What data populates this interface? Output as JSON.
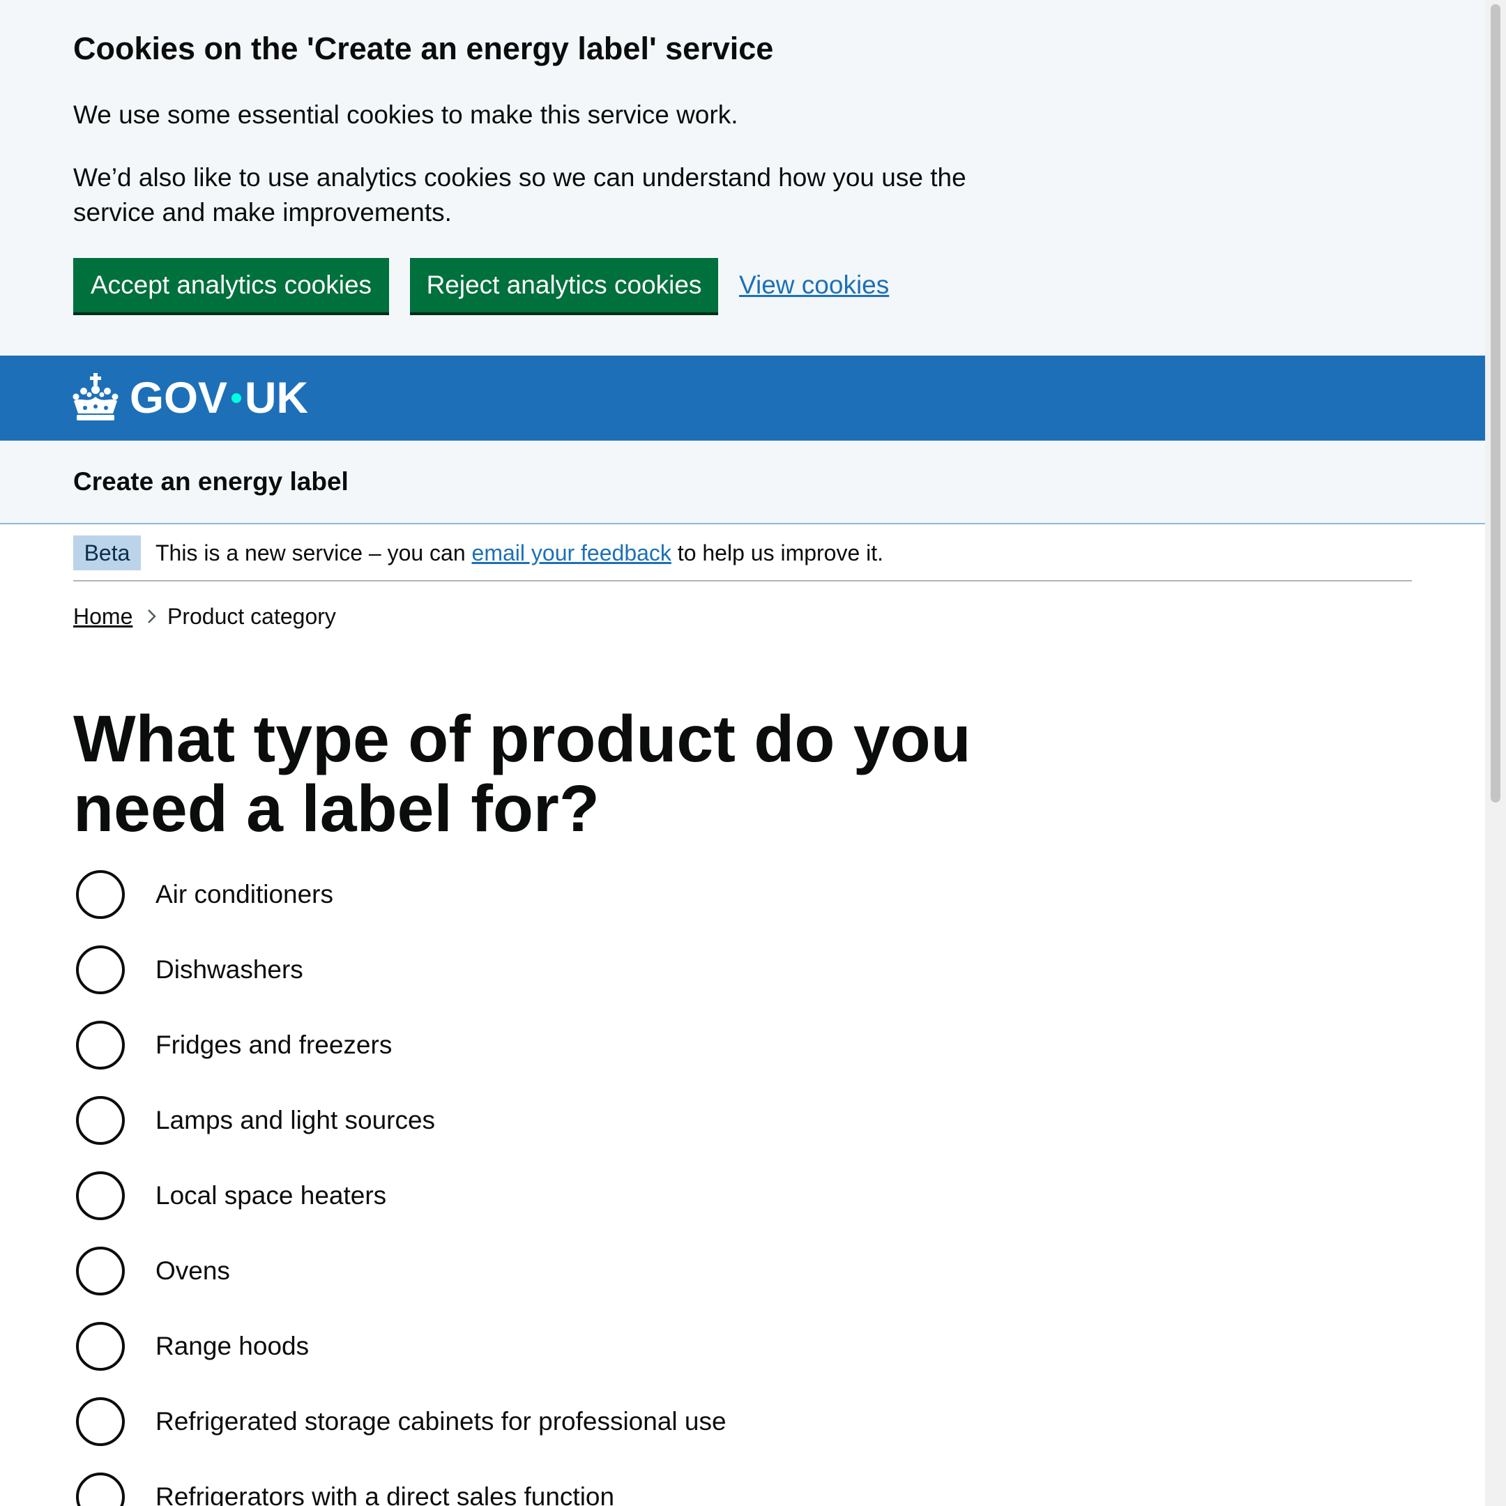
{
  "cookie_banner": {
    "heading": "Cookies on the 'Create an energy label' service",
    "essential_text": "We use some essential cookies to make this service work.",
    "analytics_text": "We’d also like to use analytics cookies so we can understand how you use the service and make improvements.",
    "accept_label": "Accept analytics cookies",
    "reject_label": "Reject analytics cookies",
    "view_label": "View cookies"
  },
  "header": {
    "logo_left": "GOV",
    "logo_right": "UK",
    "crown_icon": "crown-icon"
  },
  "service": {
    "name": "Create an energy label"
  },
  "phase_banner": {
    "tag": "Beta",
    "text_before": "This is a new service – you can ",
    "link_text": "email your feedback",
    "text_after": " to help us improve it."
  },
  "breadcrumbs": {
    "home": "Home",
    "current": "Product category",
    "separator_icon": "chevron-right-icon"
  },
  "page": {
    "title": "What type of product do you need a label for?"
  },
  "radios": [
    {
      "label": "Air conditioners"
    },
    {
      "label": "Dishwashers"
    },
    {
      "label": "Fridges and freezers"
    },
    {
      "label": "Lamps and light sources"
    },
    {
      "label": "Local space heaters"
    },
    {
      "label": "Ovens"
    },
    {
      "label": "Range hoods"
    },
    {
      "label": "Refrigerated storage cabinets for professional use"
    },
    {
      "label": "Refrigerators with a direct sales function"
    }
  ],
  "colors": {
    "brand_blue": "#1d70b8",
    "button_green": "#00703c",
    "banner_background": "#f3f7fa",
    "link": "#1d70b8",
    "text": "#0b0c0c",
    "beta_tag": "#bbd4ea",
    "dot_turquoise": "#00ffe0"
  }
}
